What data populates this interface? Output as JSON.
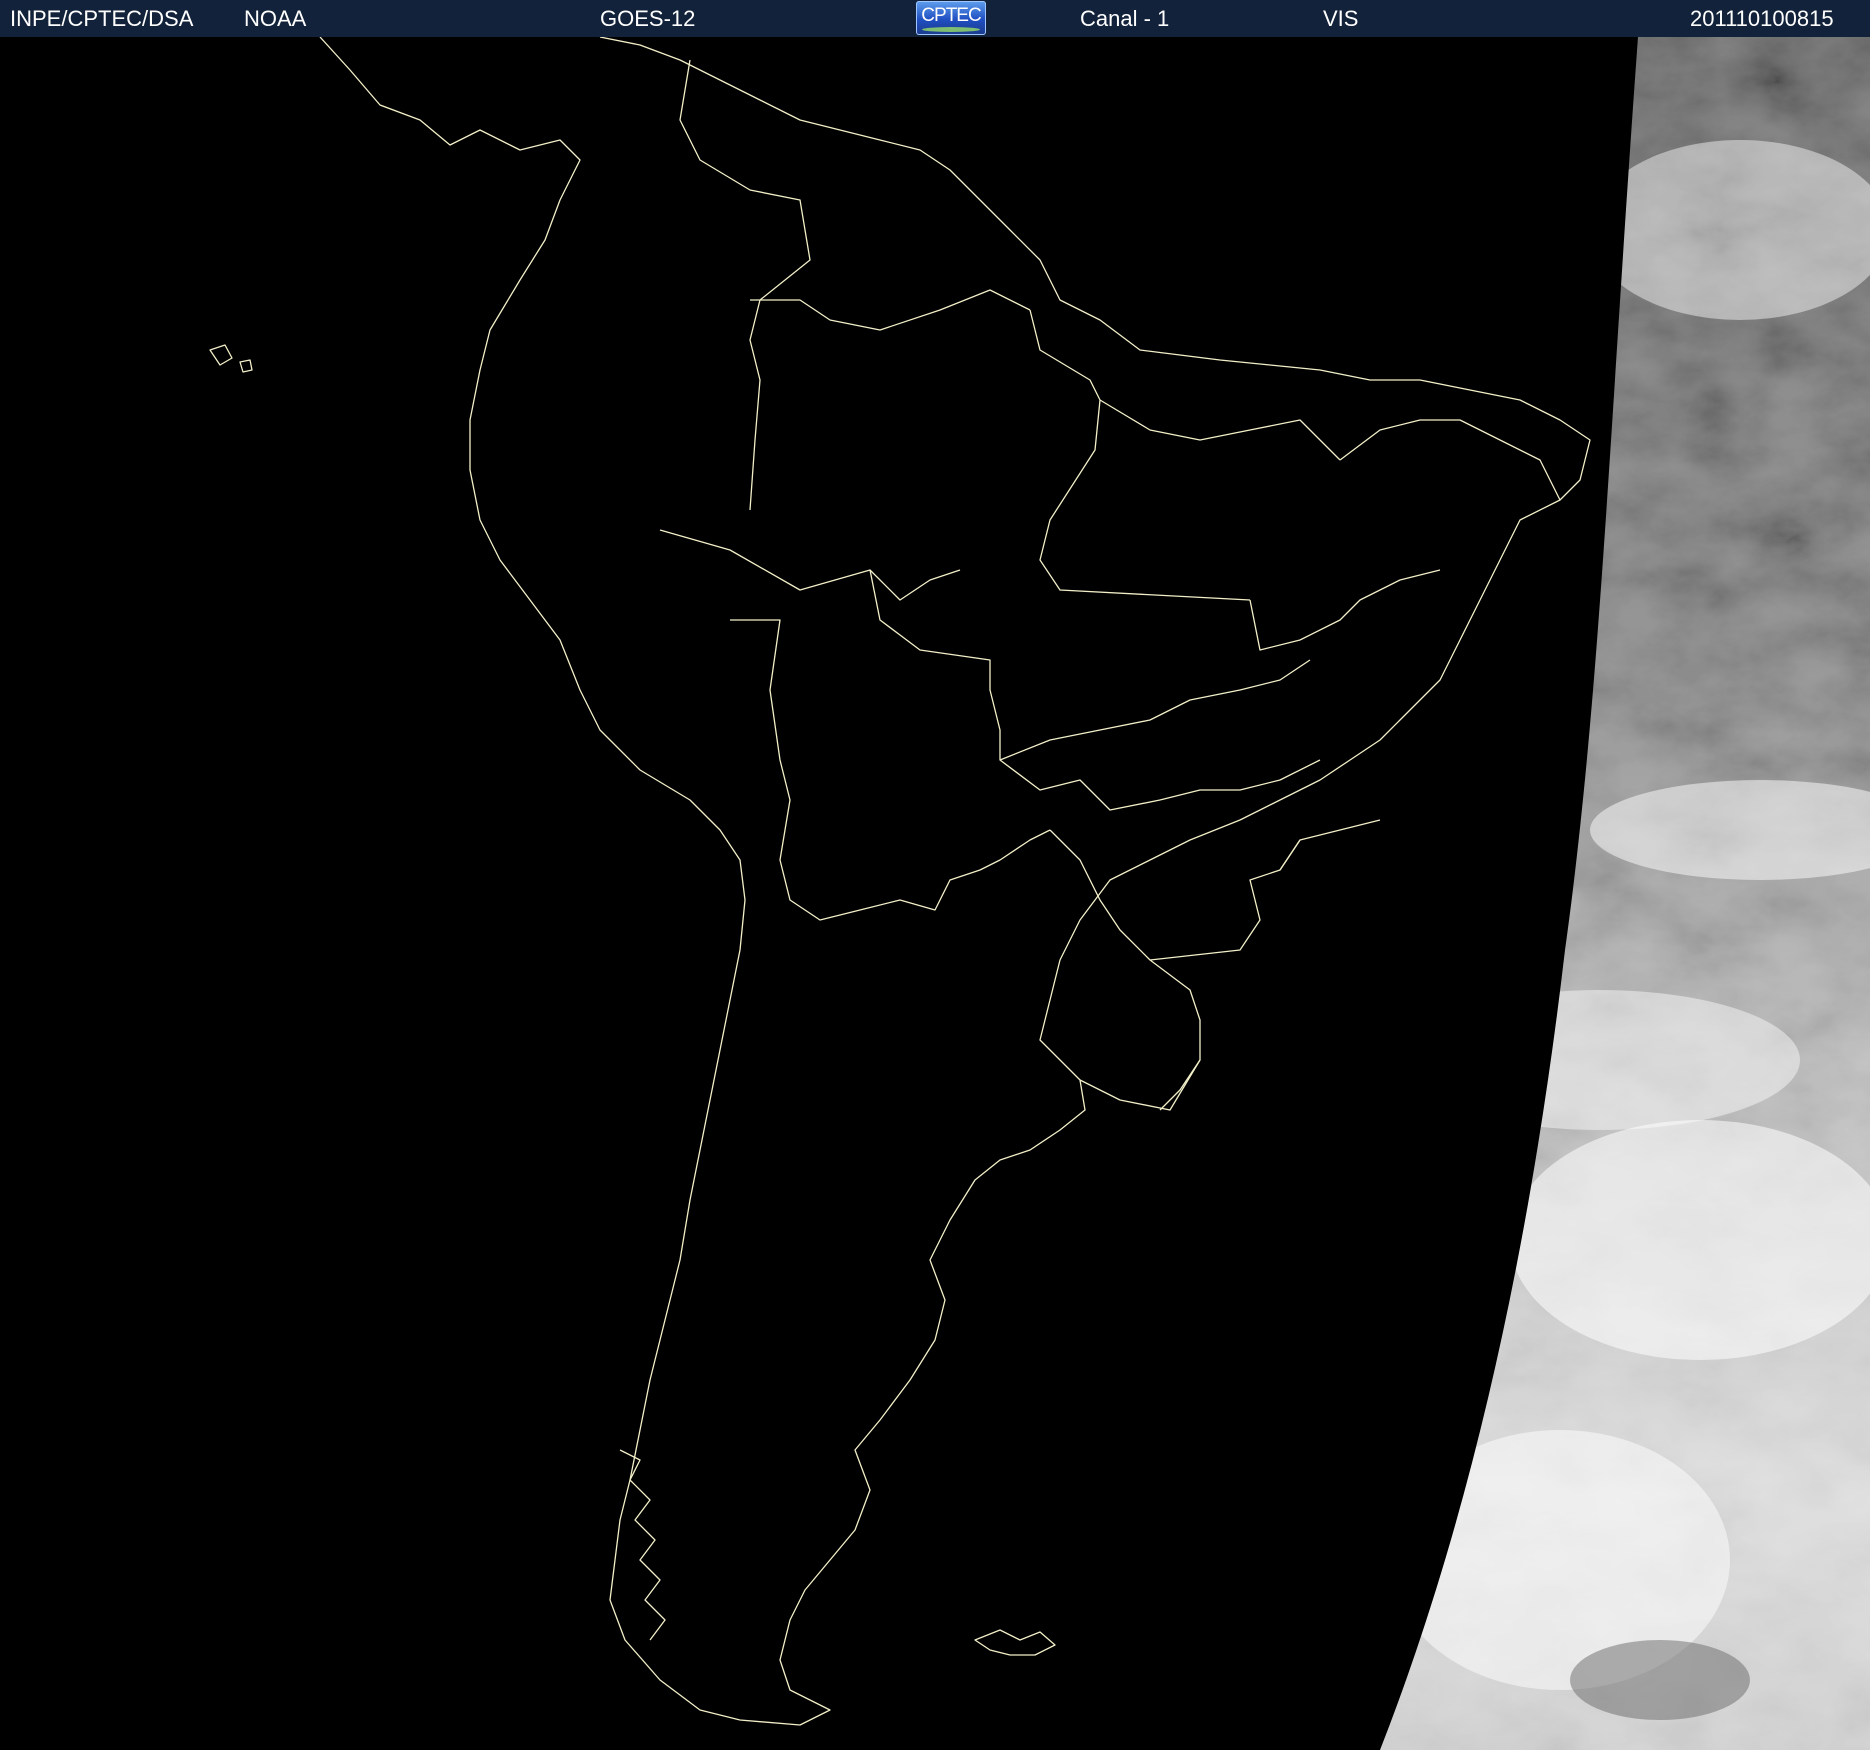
{
  "header": {
    "org": "INPE/CPTEC/DSA",
    "agency": "NOAA",
    "satellite": "GOES-12",
    "logo_text": "CPTEC",
    "channel": "Canal - 1",
    "band": "VIS",
    "timestamp": "201110100815"
  },
  "image": {
    "night_side": "black, no illumination",
    "day_side": "visible-band cloud imagery, grey to white",
    "overlay_color": "#f2efc8",
    "header_background": "#12223a"
  }
}
